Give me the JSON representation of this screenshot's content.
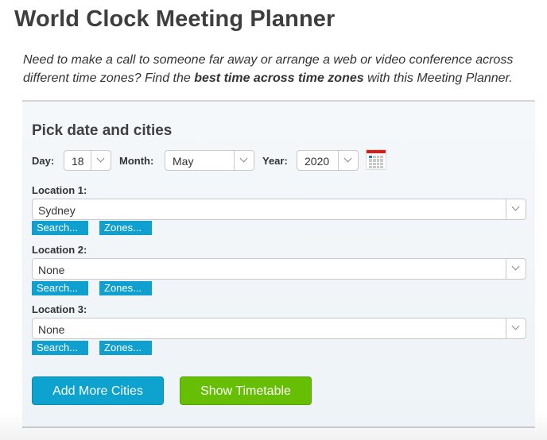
{
  "page": {
    "title": "World Clock Meeting Planner",
    "intro": {
      "before": "Need to make a call to someone far away or arrange a web or video conference across different time zones? Find the ",
      "bold": "best time across time zones",
      "after": " with this Meeting Planner."
    }
  },
  "form": {
    "heading": "Pick date and cities",
    "day": {
      "label": "Day:",
      "value": "18"
    },
    "month": {
      "label": "Month:",
      "value": "May"
    },
    "year": {
      "label": "Year:",
      "value": "2020"
    },
    "calendar_icon": "calendar-icon",
    "locations": [
      {
        "label": "Location 1:",
        "value": "Sydney",
        "search": "Search...",
        "zones": "Zones..."
      },
      {
        "label": "Location 2:",
        "value": "None",
        "search": "Search...",
        "zones": "Zones..."
      },
      {
        "label": "Location 3:",
        "value": "None",
        "search": "Search...",
        "zones": "Zones..."
      }
    ],
    "add_more_label": "Add More Cities",
    "show_timetable_label": "Show Timetable"
  },
  "colors": {
    "blue_button": "#0ea3cf",
    "green_button": "#66bf04",
    "calendar_red": "#e01818"
  }
}
